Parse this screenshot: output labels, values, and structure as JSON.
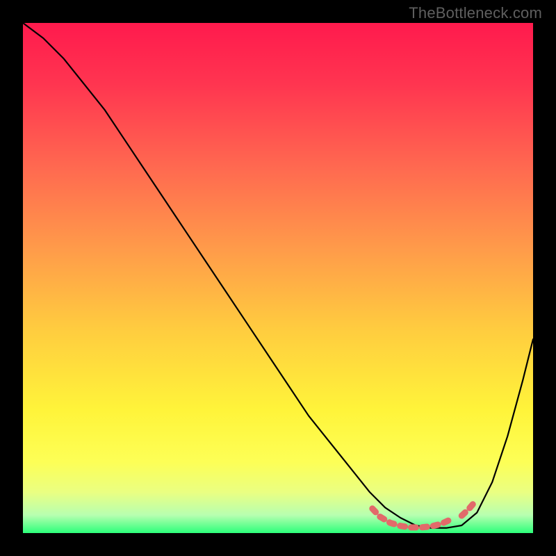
{
  "watermark": "TheBottleneck.com",
  "chart_data": {
    "type": "line",
    "title": "",
    "xlabel": "",
    "ylabel": "",
    "xlim": [
      0,
      100
    ],
    "ylim": [
      0,
      100
    ],
    "gradient_stops": [
      {
        "offset": 0.0,
        "color": "#ff1a4d"
      },
      {
        "offset": 0.12,
        "color": "#ff3550"
      },
      {
        "offset": 0.28,
        "color": "#ff6850"
      },
      {
        "offset": 0.44,
        "color": "#ff9a4a"
      },
      {
        "offset": 0.6,
        "color": "#ffcc3f"
      },
      {
        "offset": 0.76,
        "color": "#fff43a"
      },
      {
        "offset": 0.86,
        "color": "#fdff56"
      },
      {
        "offset": 0.92,
        "color": "#eaff82"
      },
      {
        "offset": 0.965,
        "color": "#b7ffb0"
      },
      {
        "offset": 1.0,
        "color": "#2cff7a"
      }
    ],
    "series": [
      {
        "name": "bottleneck-curve",
        "x": [
          0,
          4,
          8,
          12,
          16,
          20,
          24,
          28,
          32,
          36,
          40,
          44,
          48,
          52,
          56,
          60,
          64,
          68,
          71,
          74,
          77,
          80,
          83,
          86,
          89,
          92,
          95,
          98,
          100
        ],
        "y": [
          100,
          97,
          93,
          88,
          83,
          77,
          71,
          65,
          59,
          53,
          47,
          41,
          35,
          29,
          23,
          18,
          13,
          8,
          5,
          3,
          1.5,
          1,
          1,
          1.5,
          4,
          10,
          19,
          30,
          38
        ]
      }
    ],
    "marker_segment": {
      "x": [
        68.5,
        70,
        72,
        74,
        76,
        78,
        80,
        82,
        83.5
      ],
      "y": [
        4.8,
        3.2,
        2.0,
        1.4,
        1.1,
        1.1,
        1.3,
        1.8,
        2.5
      ],
      "color": "#e26a6a"
    },
    "marker_segment_right": {
      "x": [
        86,
        87.3,
        88.5
      ],
      "y": [
        3.4,
        4.6,
        6.0
      ],
      "color": "#e26a6a"
    }
  }
}
